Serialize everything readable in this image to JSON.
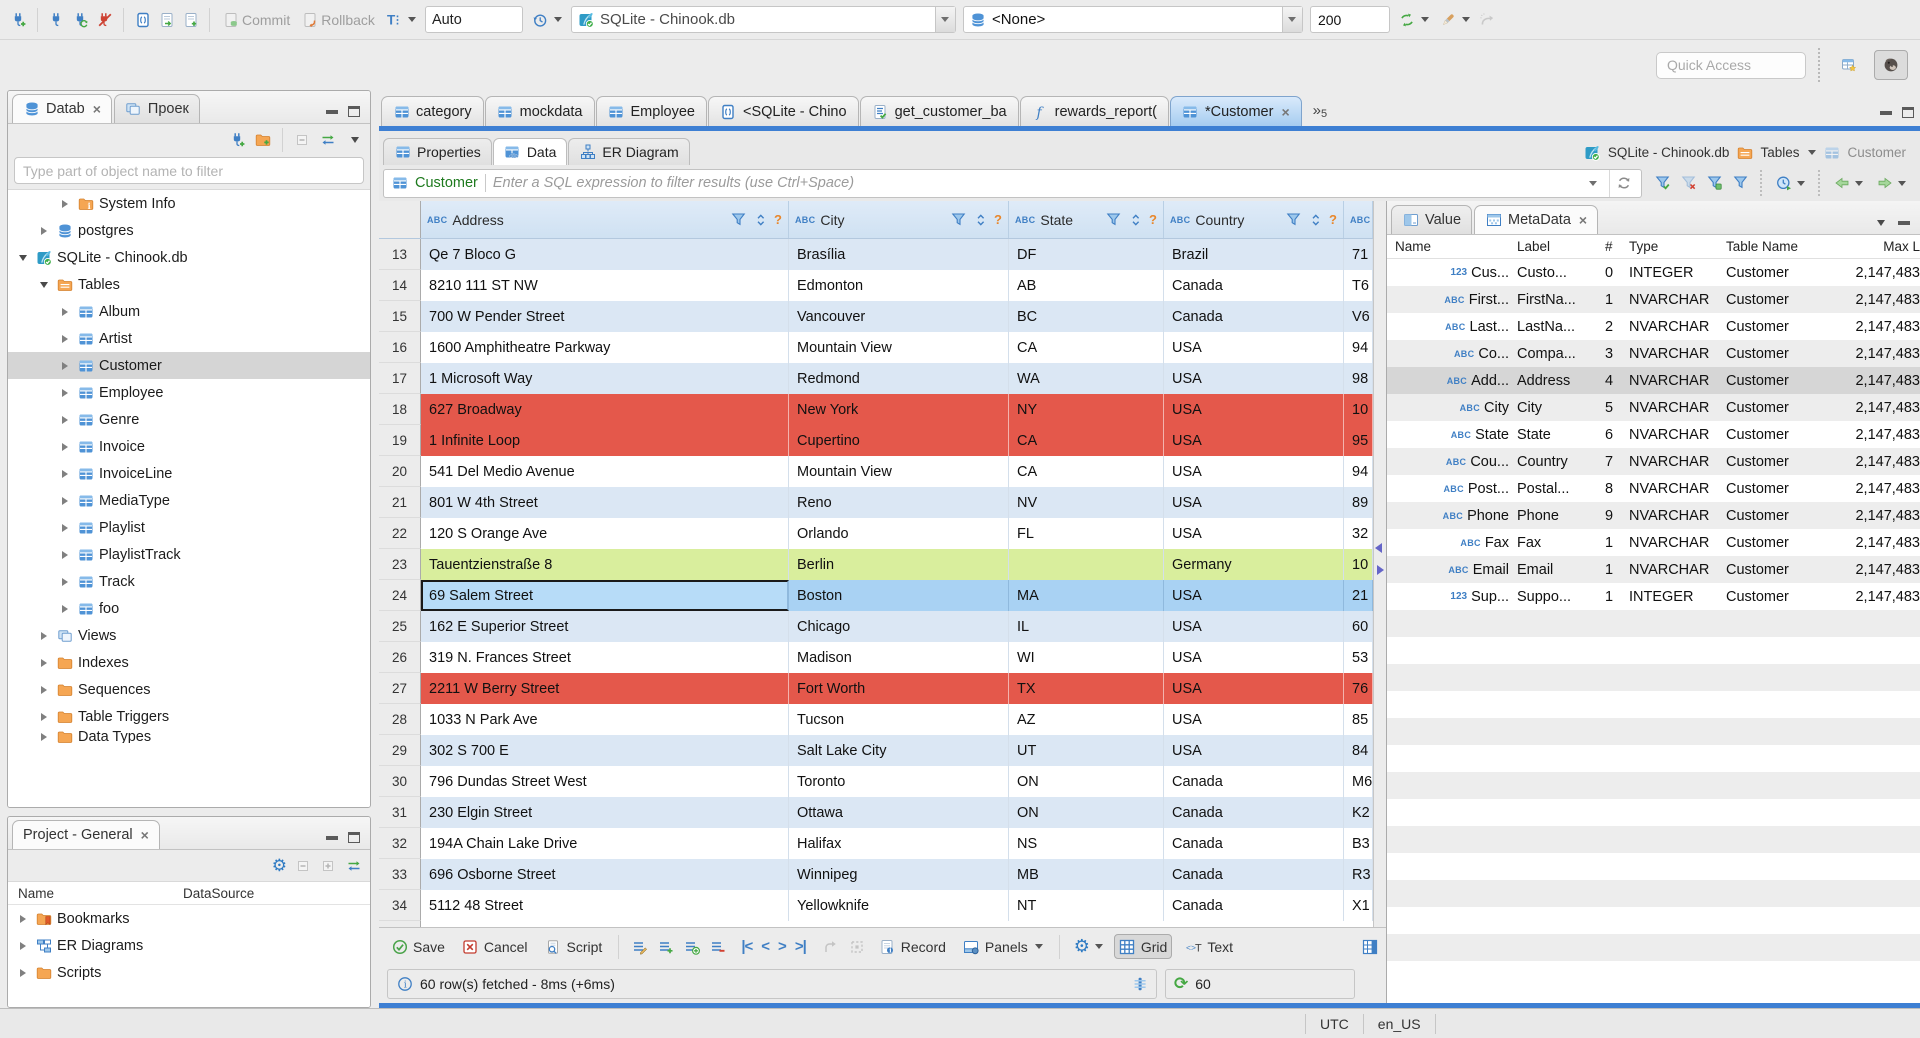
{
  "toolbar": {
    "commit": "Commit",
    "rollback": "Rollback",
    "tx_mode": "Auto",
    "connection": "SQLite - Chinook.db",
    "schema": "<None>",
    "fetch_size": "200",
    "quick_access_placeholder": "Quick Access"
  },
  "navigator": {
    "tab_database": "Datab",
    "tab_project": "Проек",
    "filter_placeholder": "Type part of object name to filter",
    "tree": [
      {
        "label": "System Info",
        "level": 2,
        "state": "collapsed",
        "icon": "folder-info"
      },
      {
        "label": "postgres",
        "level": 1,
        "state": "collapsed",
        "icon": "database"
      },
      {
        "label": "SQLite - Chinook.db",
        "level": 0,
        "state": "expanded",
        "icon": "sqlite"
      },
      {
        "label": "Tables",
        "level": 1,
        "state": "expanded",
        "icon": "table-folder"
      },
      {
        "label": "Album",
        "level": 2,
        "state": "collapsed",
        "icon": "table"
      },
      {
        "label": "Artist",
        "level": 2,
        "state": "collapsed",
        "icon": "table"
      },
      {
        "label": "Customer",
        "level": 2,
        "state": "collapsed",
        "icon": "table",
        "selected": true
      },
      {
        "label": "Employee",
        "level": 2,
        "state": "collapsed",
        "icon": "table"
      },
      {
        "label": "Genre",
        "level": 2,
        "state": "collapsed",
        "icon": "table"
      },
      {
        "label": "Invoice",
        "level": 2,
        "state": "collapsed",
        "icon": "table"
      },
      {
        "label": "InvoiceLine",
        "level": 2,
        "state": "collapsed",
        "icon": "table"
      },
      {
        "label": "MediaType",
        "level": 2,
        "state": "collapsed",
        "icon": "table"
      },
      {
        "label": "Playlist",
        "level": 2,
        "state": "collapsed",
        "icon": "table"
      },
      {
        "label": "PlaylistTrack",
        "level": 2,
        "state": "collapsed",
        "icon": "table"
      },
      {
        "label": "Track",
        "level": 2,
        "state": "collapsed",
        "icon": "table"
      },
      {
        "label": "foo",
        "level": 2,
        "state": "collapsed",
        "icon": "table"
      },
      {
        "label": "Views",
        "level": 1,
        "state": "collapsed",
        "icon": "views"
      },
      {
        "label": "Indexes",
        "level": 1,
        "state": "collapsed",
        "icon": "folder"
      },
      {
        "label": "Sequences",
        "level": 1,
        "state": "collapsed",
        "icon": "folder"
      },
      {
        "label": "Table Triggers",
        "level": 1,
        "state": "collapsed",
        "icon": "folder"
      },
      {
        "label": "Data Types",
        "level": 1,
        "state": "collapsed",
        "icon": "folder",
        "cut": true
      }
    ]
  },
  "project": {
    "title": "Project - General",
    "columns": [
      "Name",
      "DataSource"
    ],
    "items": [
      {
        "label": "Bookmarks",
        "icon": "bookmarks"
      },
      {
        "label": "ER Diagrams",
        "icon": "er"
      },
      {
        "label": "Scripts",
        "icon": "folder"
      }
    ]
  },
  "editor": {
    "tabs": [
      {
        "label": "category",
        "icon": "table"
      },
      {
        "label": "mockdata",
        "icon": "table"
      },
      {
        "label": "Employee",
        "icon": "table"
      },
      {
        "label": "<SQLite - Chino",
        "icon": "script"
      },
      {
        "label": "get_customer_ba",
        "icon": "script-check"
      },
      {
        "label": "rewards_report(",
        "icon": "function"
      },
      {
        "label": "*Customer",
        "icon": "table",
        "active": true
      }
    ],
    "overflow_glyph": "»",
    "overflow_count": "5",
    "subtabs": {
      "properties": "Properties",
      "data": "Data",
      "er_diagram": "ER Diagram"
    },
    "breadcrumb": {
      "connection": "SQLite - Chinook.db",
      "container": "Tables",
      "entity": "Customer"
    },
    "filter": {
      "table": "Customer",
      "placeholder": "Enter a SQL expression to filter results (use Ctrl+Space)"
    }
  },
  "grid": {
    "columns": [
      "Address",
      "City",
      "State",
      "Country"
    ],
    "rows": [
      {
        "n": "13",
        "address": "Qe 7 Bloco G",
        "city": "Brasília",
        "state": "DF",
        "country": "Brazil",
        "postal": "71"
      },
      {
        "n": "14",
        "address": "8210 111 ST NW",
        "city": "Edmonton",
        "state": "AB",
        "country": "Canada",
        "postal": "T6"
      },
      {
        "n": "15",
        "address": "700 W Pender Street",
        "city": "Vancouver",
        "state": "BC",
        "country": "Canada",
        "postal": "V6"
      },
      {
        "n": "16",
        "address": "1600 Amphitheatre Parkway",
        "city": "Mountain View",
        "state": "CA",
        "country": "USA",
        "postal": "94"
      },
      {
        "n": "17",
        "address": "1 Microsoft Way",
        "city": "Redmond",
        "state": "WA",
        "country": "USA",
        "postal": "98"
      },
      {
        "n": "18",
        "address": "627 Broadway",
        "city": "New York",
        "state": "NY",
        "country": "USA",
        "postal": "10",
        "highlight": "red"
      },
      {
        "n": "19",
        "address": "1 Infinite Loop",
        "city": "Cupertino",
        "state": "CA",
        "country": "USA",
        "postal": "95",
        "highlight": "red"
      },
      {
        "n": "20",
        "address": "541 Del Medio Avenue",
        "city": "Mountain View",
        "state": "CA",
        "country": "USA",
        "postal": "94"
      },
      {
        "n": "21",
        "address": "801 W 4th Street",
        "city": "Reno",
        "state": "NV",
        "country": "USA",
        "postal": "89"
      },
      {
        "n": "22",
        "address": "120 S Orange Ave",
        "city": "Orlando",
        "state": "FL",
        "country": "USA",
        "postal": "32"
      },
      {
        "n": "23",
        "address": "Tauentzienstraße 8",
        "city": "Berlin",
        "state": "",
        "country": "Germany",
        "postal": "10",
        "highlight": "green"
      },
      {
        "n": "24",
        "address": "69 Salem Street",
        "city": "Boston",
        "state": "MA",
        "country": "USA",
        "postal": "21",
        "highlight": "selected"
      },
      {
        "n": "25",
        "address": "162 E Superior Street",
        "city": "Chicago",
        "state": "IL",
        "country": "USA",
        "postal": "60"
      },
      {
        "n": "26",
        "address": "319 N. Frances Street",
        "city": "Madison",
        "state": "WI",
        "country": "USA",
        "postal": "53"
      },
      {
        "n": "27",
        "address": "2211 W Berry Street",
        "city": "Fort Worth",
        "state": "TX",
        "country": "USA",
        "postal": "76",
        "highlight": "red"
      },
      {
        "n": "28",
        "address": "1033 N Park Ave",
        "city": "Tucson",
        "state": "AZ",
        "country": "USA",
        "postal": "85"
      },
      {
        "n": "29",
        "address": "302 S 700 E",
        "city": "Salt Lake City",
        "state": "UT",
        "country": "USA",
        "postal": "84"
      },
      {
        "n": "30",
        "address": "796 Dundas Street West",
        "city": "Toronto",
        "state": "ON",
        "country": "Canada",
        "postal": "M6"
      },
      {
        "n": "31",
        "address": "230 Elgin Street",
        "city": "Ottawa",
        "state": "ON",
        "country": "Canada",
        "postal": "K2"
      },
      {
        "n": "32",
        "address": "194A Chain Lake Drive",
        "city": "Halifax",
        "state": "NS",
        "country": "Canada",
        "postal": "B3"
      },
      {
        "n": "33",
        "address": "696 Osborne Street",
        "city": "Winnipeg",
        "state": "MB",
        "country": "Canada",
        "postal": "R3"
      },
      {
        "n": "34",
        "address": "5112 48 Street",
        "city": "Yellowknife",
        "state": "NT",
        "country": "Canada",
        "postal": "X1"
      }
    ]
  },
  "metadata_panel": {
    "tab_value": "Value",
    "tab_metadata": "MetaData",
    "columns": [
      "Name",
      "Label",
      "#",
      "Type",
      "Table Name",
      "Max L"
    ],
    "rows": [
      {
        "kind": "num",
        "name": "Cus...",
        "label": "Custo...",
        "num": "0",
        "type": "INTEGER",
        "table": "Customer",
        "max": "2,147,483"
      },
      {
        "kind": "str",
        "name": "First...",
        "label": "FirstNa...",
        "num": "1",
        "type": "NVARCHAR",
        "table": "Customer",
        "max": "2,147,483"
      },
      {
        "kind": "str",
        "name": "Last...",
        "label": "LastNa...",
        "num": "2",
        "type": "NVARCHAR",
        "table": "Customer",
        "max": "2,147,483"
      },
      {
        "kind": "str",
        "name": "Co...",
        "label": "Compa...",
        "num": "3",
        "type": "NVARCHAR",
        "table": "Customer",
        "max": "2,147,483"
      },
      {
        "kind": "str",
        "name": "Add...",
        "label": "Address",
        "num": "4",
        "type": "NVARCHAR",
        "table": "Customer",
        "max": "2,147,483",
        "selected": true
      },
      {
        "kind": "str",
        "name": "City",
        "label": "City",
        "num": "5",
        "type": "NVARCHAR",
        "table": "Customer",
        "max": "2,147,483"
      },
      {
        "kind": "str",
        "name": "State",
        "label": "State",
        "num": "6",
        "type": "NVARCHAR",
        "table": "Customer",
        "max": "2,147,483"
      },
      {
        "kind": "str",
        "name": "Cou...",
        "label": "Country",
        "num": "7",
        "type": "NVARCHAR",
        "table": "Customer",
        "max": "2,147,483"
      },
      {
        "kind": "str",
        "name": "Post...",
        "label": "Postal...",
        "num": "8",
        "type": "NVARCHAR",
        "table": "Customer",
        "max": "2,147,483"
      },
      {
        "kind": "str",
        "name": "Phone",
        "label": "Phone",
        "num": "9",
        "type": "NVARCHAR",
        "table": "Customer",
        "max": "2,147,483"
      },
      {
        "kind": "str",
        "name": "Fax",
        "label": "Fax",
        "num": "1",
        "type": "NVARCHAR",
        "table": "Customer",
        "max": "2,147,483"
      },
      {
        "kind": "str",
        "name": "Email",
        "label": "Email",
        "num": "1",
        "type": "NVARCHAR",
        "table": "Customer",
        "max": "2,147,483"
      },
      {
        "kind": "num",
        "name": "Sup...",
        "label": "Suppo...",
        "num": "1",
        "type": "INTEGER",
        "table": "Customer",
        "max": "2,147,483"
      }
    ]
  },
  "result_toolbar": {
    "save": "Save",
    "cancel": "Cancel",
    "script": "Script",
    "record": "Record",
    "panels": "Panels",
    "grid": "Grid",
    "text": "Text"
  },
  "result_status": {
    "message": "60 row(s) fetched - 8ms (+6ms)",
    "auto_refresh": "60"
  },
  "statusbar": {
    "timezone": "UTC",
    "locale": "en_US"
  }
}
